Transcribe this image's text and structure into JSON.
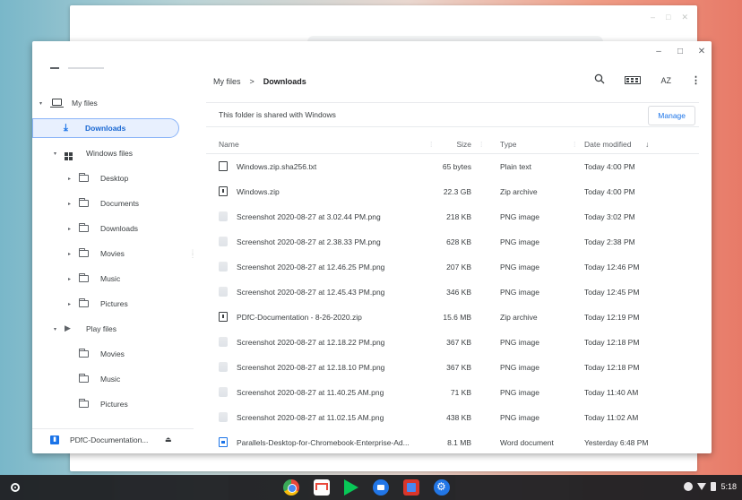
{
  "window": {
    "controls": {
      "minimize": "–",
      "maximize": "□",
      "close": "✕"
    }
  },
  "sidebar": {
    "my_files": "My files",
    "downloads": "Downloads",
    "windows_files": "Windows files",
    "windows_children": [
      "Desktop",
      "Documents",
      "Downloads",
      "Movies",
      "Music",
      "Pictures"
    ],
    "play_files": "Play files",
    "play_children": [
      "Movies",
      "Music",
      "Pictures"
    ],
    "usb_label": "PDfC-Documentation...",
    "eject": "⏏"
  },
  "toolbar": {
    "crumb_root": "My files",
    "crumb_sep": ">",
    "crumb_current": "Downloads",
    "search_icon": "search-icon",
    "grid_icon": "grid-view-icon",
    "sort_label": "AZ",
    "more_label": "⋮"
  },
  "banner": {
    "text": "This folder is shared with Windows",
    "manage": "Manage"
  },
  "table": {
    "headers": {
      "name": "Name",
      "size": "Size",
      "type": "Type",
      "date": "Date modified",
      "sort_arrow": "↓"
    },
    "rows": [
      {
        "icon": "document",
        "name": "Windows.zip.sha256.txt",
        "size": "65 bytes",
        "type": "Plain text",
        "date": "Today 4:00 PM"
      },
      {
        "icon": "archive",
        "name": "Windows.zip",
        "size": "22.3 GB",
        "type": "Zip archive",
        "date": "Today 4:00 PM"
      },
      {
        "icon": "image",
        "name": "Screenshot 2020-08-27 at 3.02.44 PM.png",
        "size": "218 KB",
        "type": "PNG image",
        "date": "Today 3:02 PM"
      },
      {
        "icon": "image",
        "name": "Screenshot 2020-08-27 at 2.38.33 PM.png",
        "size": "628 KB",
        "type": "PNG image",
        "date": "Today 2:38 PM"
      },
      {
        "icon": "image",
        "name": "Screenshot 2020-08-27 at 12.46.25 PM.png",
        "size": "207 KB",
        "type": "PNG image",
        "date": "Today 12:46 PM"
      },
      {
        "icon": "image",
        "name": "Screenshot 2020-08-27 at 12.45.43 PM.png",
        "size": "346 KB",
        "type": "PNG image",
        "date": "Today 12:45 PM"
      },
      {
        "icon": "archive",
        "name": "PDfC-Documentation - 8-26-2020.zip",
        "size": "15.6 MB",
        "type": "Zip archive",
        "date": "Today 12:19 PM"
      },
      {
        "icon": "image",
        "name": "Screenshot 2020-08-27 at 12.18.22 PM.png",
        "size": "367 KB",
        "type": "PNG image",
        "date": "Today 12:18 PM"
      },
      {
        "icon": "image",
        "name": "Screenshot 2020-08-27 at 12.18.10 PM.png",
        "size": "367 KB",
        "type": "PNG image",
        "date": "Today 12:18 PM"
      },
      {
        "icon": "image",
        "name": "Screenshot 2020-08-27 at 11.40.25 AM.png",
        "size": "71 KB",
        "type": "PNG image",
        "date": "Today 11:40 AM"
      },
      {
        "icon": "image",
        "name": "Screenshot 2020-08-27 at 11.02.15 AM.png",
        "size": "438 KB",
        "type": "PNG image",
        "date": "Today 11:02 AM"
      },
      {
        "icon": "word",
        "name": "Parallels-Desktop-for-Chromebook-Enterprise-Ad...",
        "size": "8.1 MB",
        "type": "Word document",
        "date": "Yesterday 6:48 PM"
      }
    ]
  },
  "shelf": {
    "apps": [
      "chrome-icon",
      "gmail-icon",
      "play-store-icon",
      "files-icon",
      "parallels-icon",
      "settings-icon"
    ],
    "time": "5:18"
  },
  "colors": {
    "accent": "#1a73e8",
    "selected_bg": "#e8f0fe",
    "shelf": "#202124"
  }
}
